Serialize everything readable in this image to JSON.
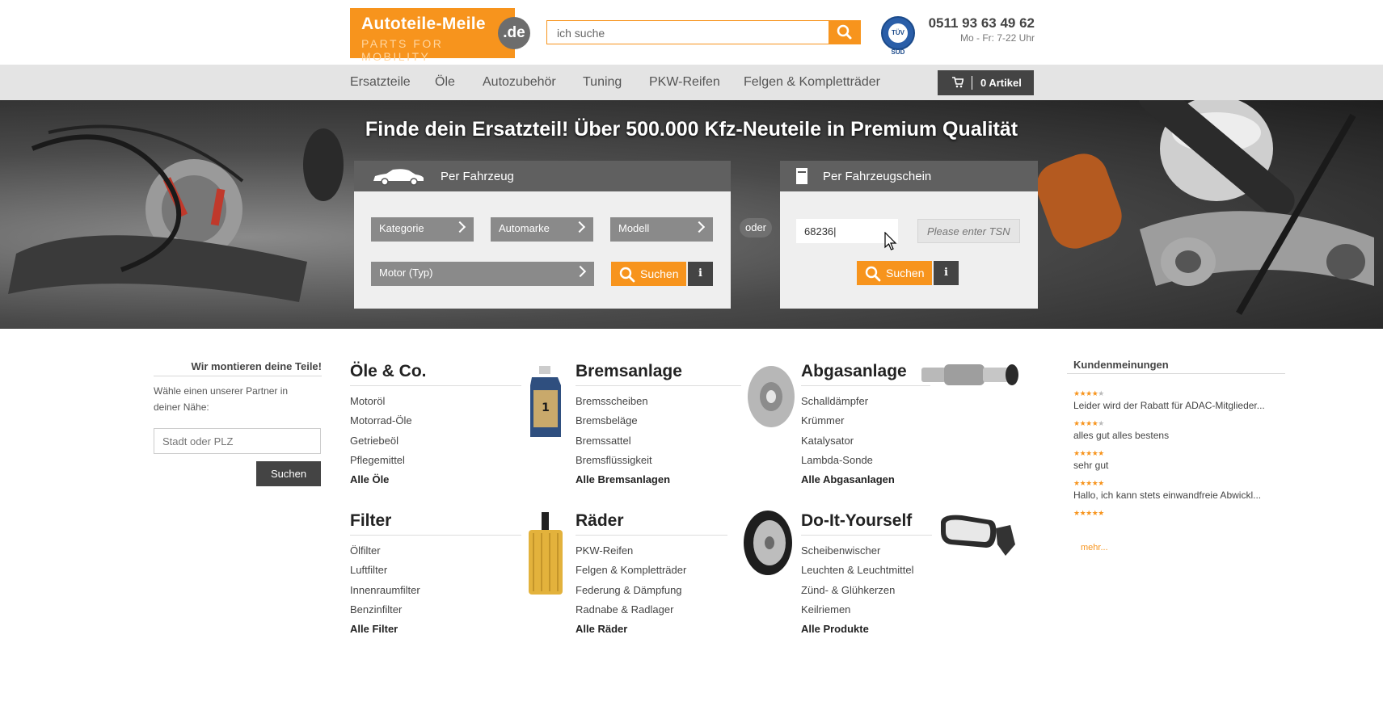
{
  "header": {
    "logo_name": "Autoteile-Meile",
    "logo_tld": ".de",
    "logo_tagline": "PARTS FOR MOBILITY",
    "search_value": "ich suche",
    "tuv_label": "TÜV SÜD",
    "phone": "0511 93 63 49 62",
    "hours": "Mo - Fr: 7-22 Uhr"
  },
  "nav": {
    "items": [
      "Ersatzteile",
      "Öle",
      "Autozubehör",
      "Tuning",
      "PKW-Reifen",
      "Felgen & Kompletträder"
    ],
    "cart_label": "0 Artikel"
  },
  "hero": {
    "title": "Finde dein Ersatzteil! Über 500.000 Kfz-Neuteile in Premium Qualität",
    "vehicle_panel": {
      "title": "Per Fahrzeug",
      "dropdowns": [
        "Kategorie",
        "Automarke",
        "Modell",
        "Motor (Typ)"
      ],
      "search_label": "Suchen",
      "info_label": "i"
    },
    "or_label": "oder",
    "registration_panel": {
      "title": "Per Fahrzeugschein",
      "hsn_value": "68236|",
      "tsn_placeholder": "Please enter TSN",
      "search_label": "Suchen",
      "info_label": "i"
    }
  },
  "partner": {
    "title": "Wir montieren deine Teile!",
    "text": "Wähle einen unserer Partner in deiner Nähe:",
    "input_placeholder": "Stadt oder PLZ",
    "button": "Suchen"
  },
  "categories": [
    {
      "title": "Öle & Co.",
      "items": [
        "Motoröl",
        "Motorrad-Öle",
        "Getriebeöl",
        "Pflegemittel"
      ],
      "all": "Alle Öle"
    },
    {
      "title": "Bremsanlage",
      "items": [
        "Bremsscheiben",
        "Bremsbeläge",
        "Bremssattel",
        "Bremsflüssigkeit"
      ],
      "all": "Alle Bremsanlagen"
    },
    {
      "title": "Abgasanlage",
      "items": [
        "Schalldämpfer",
        "Krümmer",
        "Katalysator",
        "Lambda-Sonde"
      ],
      "all": "Alle Abgasanlagen"
    },
    {
      "title": "Filter",
      "items": [
        "Ölfilter",
        "Luftfilter",
        "Innenraumfilter",
        "Benzinfilter"
      ],
      "all": "Alle Filter"
    },
    {
      "title": "Räder",
      "items": [
        "PKW-Reifen",
        "Felgen & Kompletträder",
        "Federung & Dämpfung",
        "Radnabe & Radlager"
      ],
      "all": "Alle Räder"
    },
    {
      "title": "Do-It-Yourself",
      "items": [
        "Scheibenwischer",
        "Leuchten & Leuchtmittel",
        "Zünd- & Glühkerzen",
        "Keilriemen"
      ],
      "all": "Alle Produkte"
    }
  ],
  "reviews": {
    "title": "Kundenmeinungen",
    "items": [
      {
        "rating": 4,
        "text": "Leider wird der Rabatt für ADAC-Mitglieder..."
      },
      {
        "rating": 4,
        "text": "alles gut alles bestens"
      },
      {
        "rating": 5,
        "text": "sehr gut"
      },
      {
        "rating": 5,
        "text": "Hallo, ich kann stets einwandfreie Abwickl..."
      },
      {
        "rating": 5,
        "text": ""
      }
    ],
    "more": "mehr..."
  },
  "colors": {
    "accent": "#f7941d",
    "dark": "#444444",
    "nav_bg": "#e4e4e4"
  }
}
